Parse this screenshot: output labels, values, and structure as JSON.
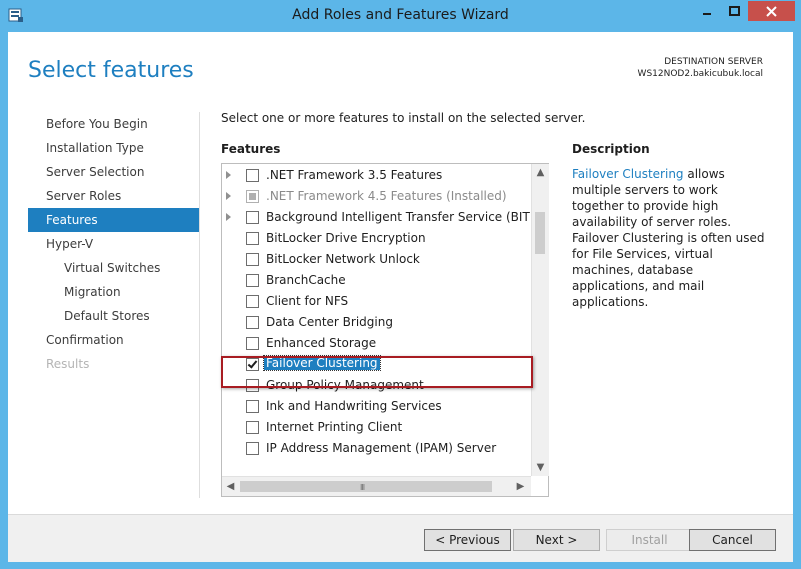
{
  "window": {
    "title": "Add Roles and Features Wizard",
    "minimize_glyph": "—",
    "maximize_glyph": "□",
    "close_glyph": "✕"
  },
  "header": {
    "page_title": "Select features",
    "destination_label": "DESTINATION SERVER",
    "destination_server": "WS12NOD2.bakicubuk.local"
  },
  "nav": {
    "items": [
      {
        "label": "Before You Begin"
      },
      {
        "label": "Installation Type"
      },
      {
        "label": "Server Selection"
      },
      {
        "label": "Server Roles"
      },
      {
        "label": "Features"
      },
      {
        "label": "Hyper-V"
      },
      {
        "label": "Virtual Switches"
      },
      {
        "label": "Migration"
      },
      {
        "label": "Default Stores"
      },
      {
        "label": "Confirmation"
      },
      {
        "label": "Results"
      }
    ]
  },
  "main": {
    "intro": "Select one or more features to install on the selected server.",
    "features_heading": "Features",
    "features": [
      {
        "label": ".NET Framework 3.5 Features",
        "state": "unchecked",
        "expandable": true
      },
      {
        "label": ".NET Framework 4.5 Features (Installed)",
        "state": "partial",
        "expandable": true
      },
      {
        "label": "Background Intelligent Transfer Service (BITS)",
        "state": "unchecked",
        "expandable": true
      },
      {
        "label": "BitLocker Drive Encryption",
        "state": "unchecked",
        "expandable": false
      },
      {
        "label": "BitLocker Network Unlock",
        "state": "unchecked",
        "expandable": false
      },
      {
        "label": "BranchCache",
        "state": "unchecked",
        "expandable": false
      },
      {
        "label": "Client for NFS",
        "state": "unchecked",
        "expandable": false
      },
      {
        "label": "Data Center Bridging",
        "state": "unchecked",
        "expandable": false
      },
      {
        "label": "Enhanced Storage",
        "state": "unchecked",
        "expandable": false
      },
      {
        "label": "Failover Clustering",
        "state": "checked",
        "expandable": false
      },
      {
        "label": "Group Policy Management",
        "state": "unchecked",
        "expandable": false
      },
      {
        "label": "Ink and Handwriting Services",
        "state": "unchecked",
        "expandable": false
      },
      {
        "label": "Internet Printing Client",
        "state": "unchecked",
        "expandable": false
      },
      {
        "label": "IP Address Management (IPAM) Server",
        "state": "unchecked",
        "expandable": false
      }
    ],
    "scroll_up": "▲",
    "scroll_down": "▼",
    "scroll_left": "◀",
    "scroll_right": "▶",
    "grip": "III"
  },
  "description": {
    "heading": "Description",
    "link": "Failover Clustering",
    "text": " allows multiple servers to work together to provide high availability of server roles. Failover Clustering is often used for File Services, virtual machines, database applications, and mail applications."
  },
  "footer": {
    "previous": "< Previous",
    "next": "Next >",
    "install": "Install",
    "cancel": "Cancel"
  },
  "colors": {
    "accent": "#1e7fc0",
    "titlebar": "#5cb6e8",
    "close": "#c7504b",
    "highlight_border": "#a81c22"
  }
}
